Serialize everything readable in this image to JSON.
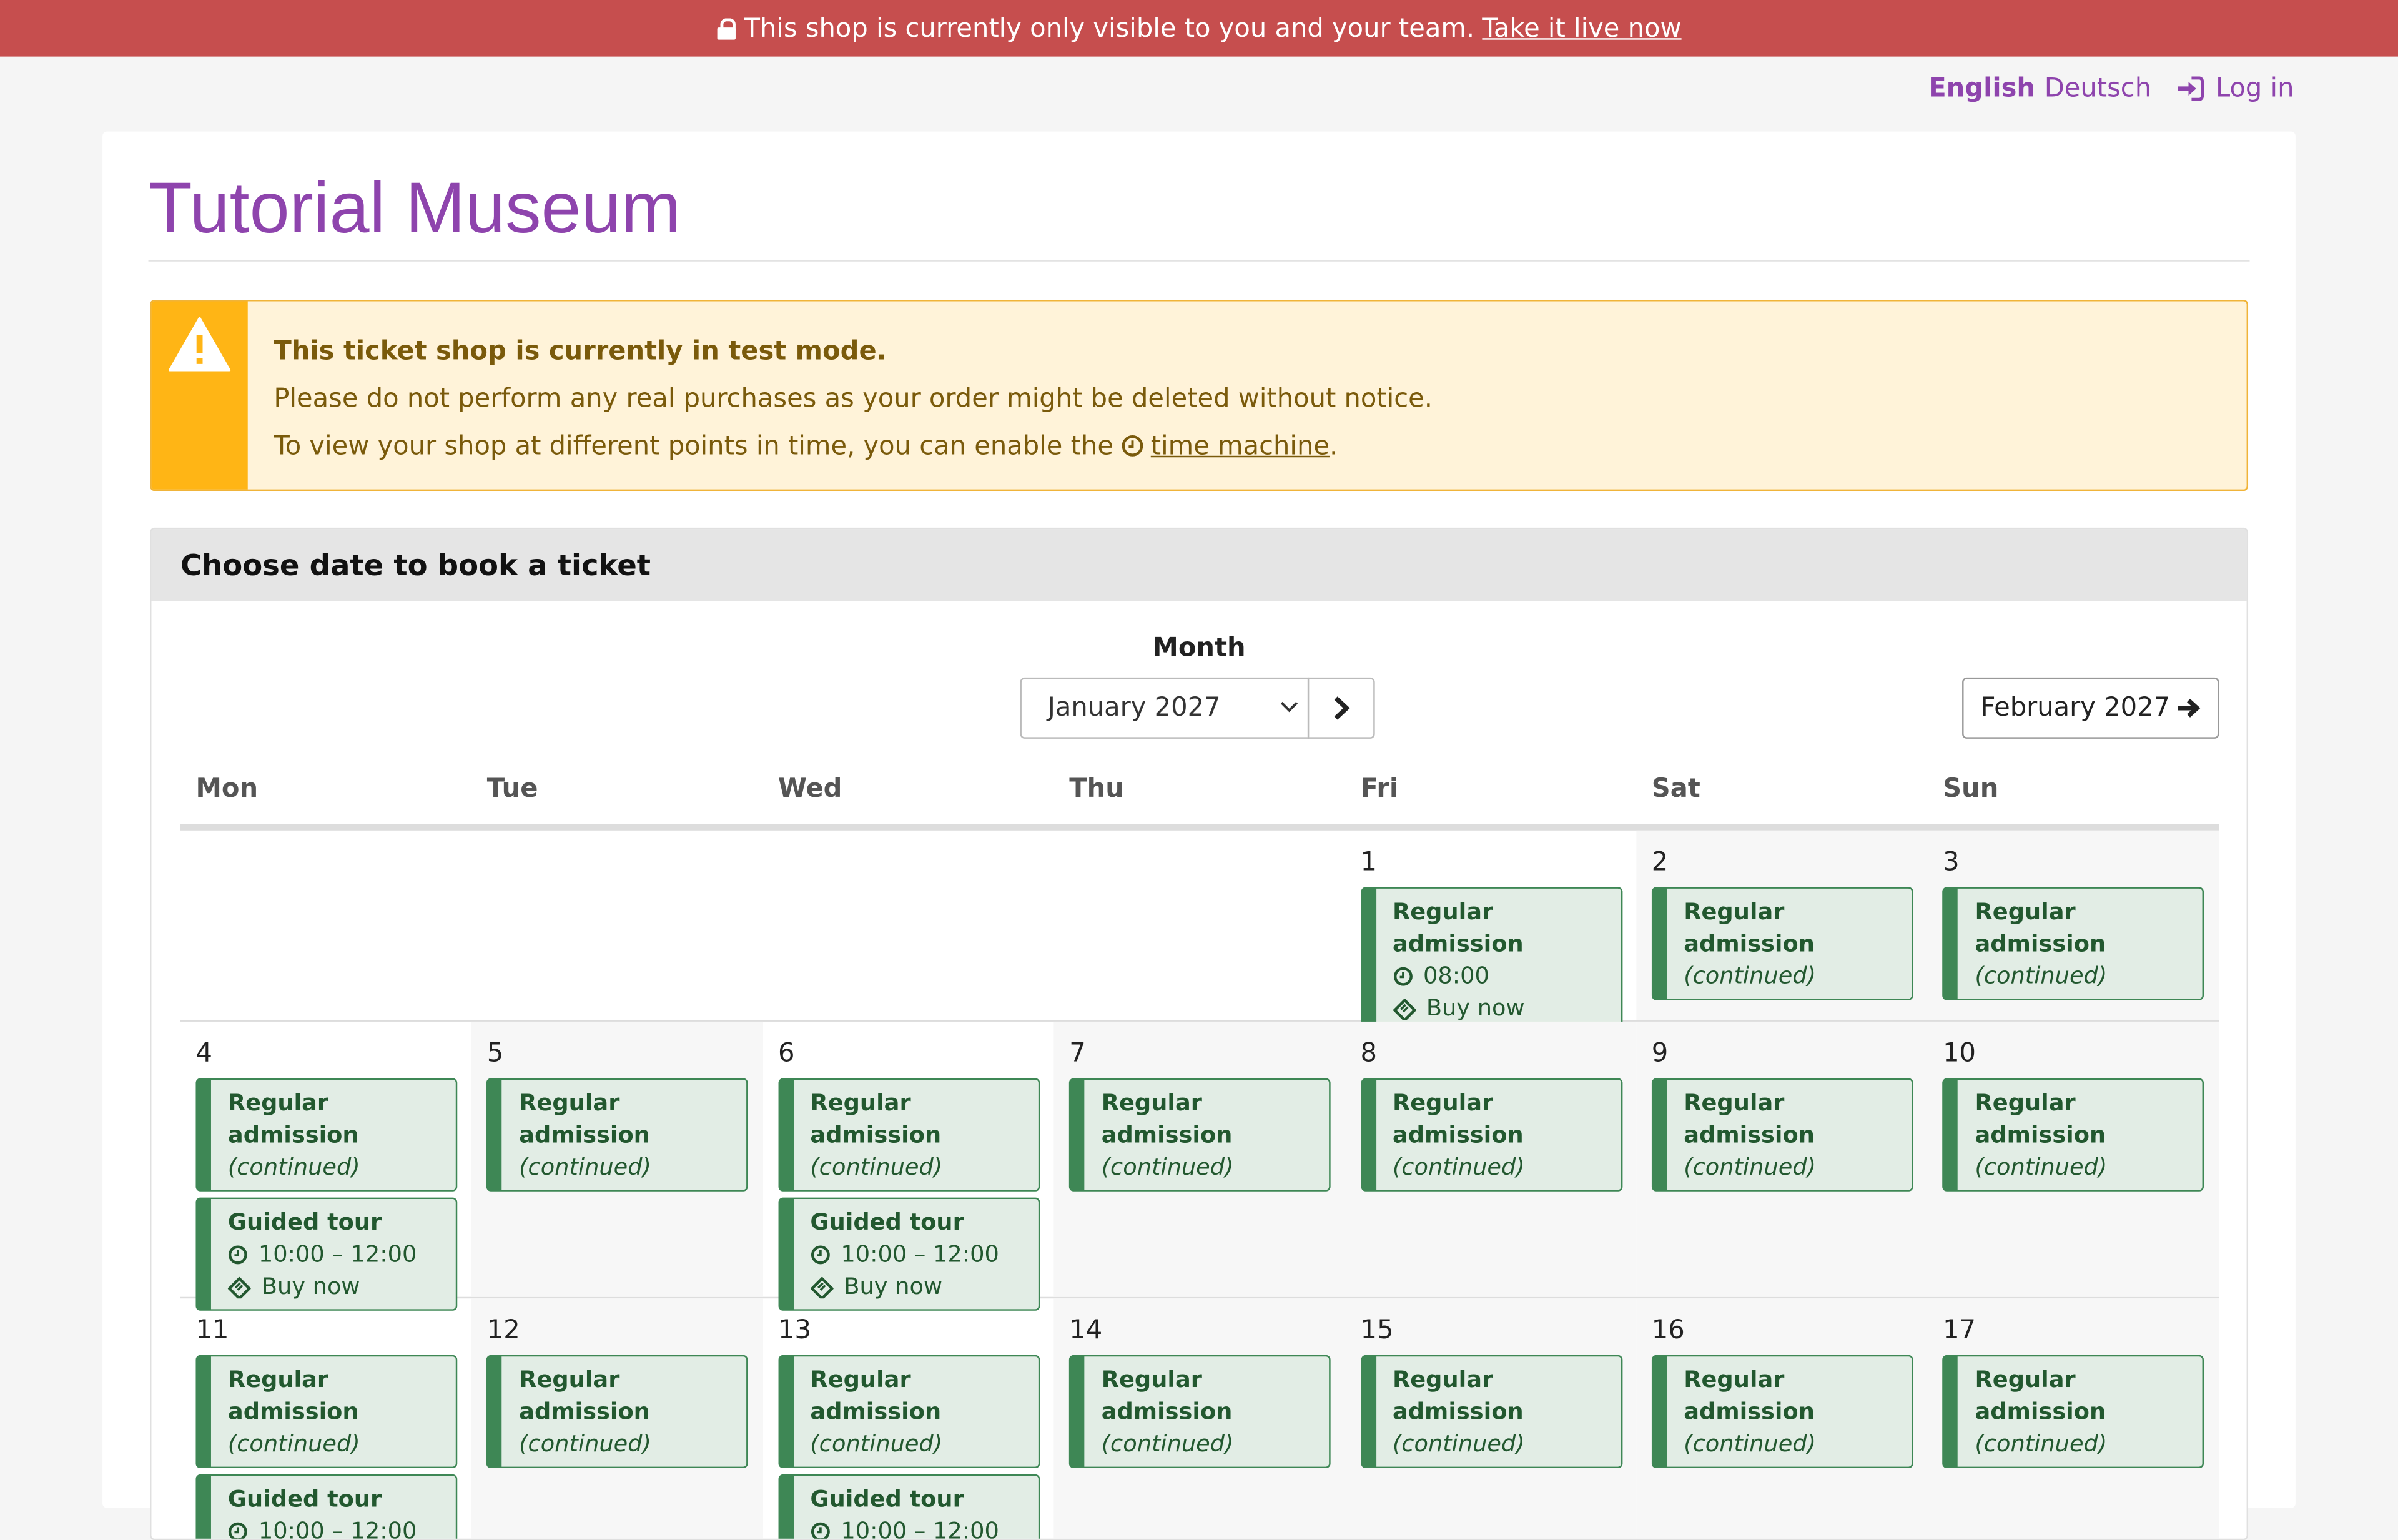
{
  "banner": {
    "text": "This shop is currently only visible to you and your team.",
    "link": "Take it live now"
  },
  "nav": {
    "lang_active": "English",
    "lang_other": "Deutsch",
    "login": "Log in"
  },
  "page_title": "Tutorial Museum",
  "alert": {
    "heading": "This ticket shop is currently in test mode.",
    "line1": "Please do not perform any real purchases as your order might be deleted without notice.",
    "line2_prefix": "To view your shop at different points in time, you can enable the",
    "line2_link": "time machine",
    "line2_suffix": "."
  },
  "calendar": {
    "heading": "Choose date to book a ticket",
    "month_label": "Month",
    "month_value": "January 2027",
    "next_month_button": "February 2027",
    "weekdays": [
      "Mon",
      "Tue",
      "Wed",
      "Thu",
      "Fri",
      "Sat",
      "Sun"
    ],
    "events": {
      "regular": "Regular admission",
      "continued": "(continued)",
      "guided": "Guided tour",
      "time_regular": "08:00",
      "time_guided": "10:00 – 12:00",
      "buy": "Buy now"
    },
    "days": [
      "1",
      "2",
      "3",
      "4",
      "5",
      "6",
      "7",
      "8",
      "9",
      "10",
      "11",
      "12",
      "13",
      "14",
      "15",
      "16",
      "17"
    ]
  },
  "colors": {
    "brand": "#8e44ad",
    "banner": "#c64e4e",
    "alert_accent": "#ffb515",
    "event": "#3e8755"
  }
}
